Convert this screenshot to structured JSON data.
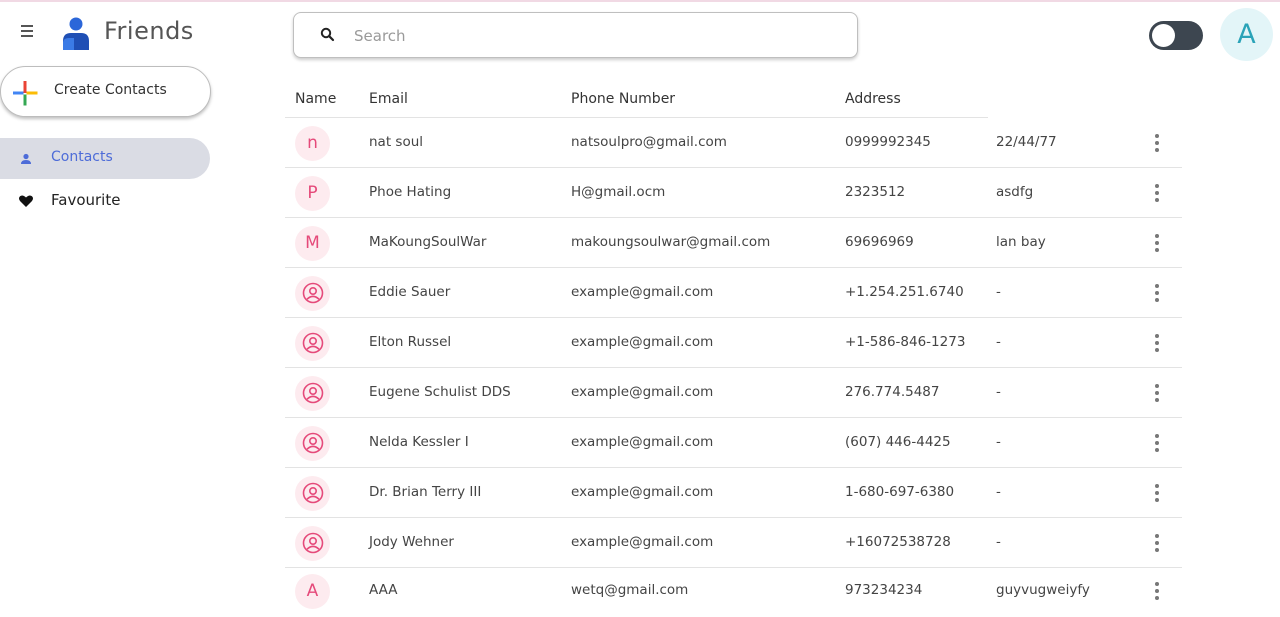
{
  "header": {
    "app_title": "Friends",
    "search_placeholder": "Search",
    "search_value": "",
    "avatar_letter": "A",
    "theme_toggle_on": false
  },
  "sidebar": {
    "create_label": "Create Contacts",
    "items": [
      {
        "label": "Contacts",
        "icon": "person-icon",
        "active": true
      },
      {
        "label": "Favourite",
        "icon": "heart-icon",
        "active": false
      }
    ]
  },
  "table": {
    "columns": [
      "Name",
      "Email",
      "Phone Number",
      "Address"
    ],
    "rows": [
      {
        "avatar": "n",
        "name": "nat soul",
        "email": "natsoulpro@gmail.com",
        "phone": "0999992345",
        "address": "22/44/77"
      },
      {
        "avatar": "P",
        "name": "Phoe Hating",
        "email": "H@gmail.ocm",
        "phone": "2323512",
        "address": "asdfg"
      },
      {
        "avatar": "M",
        "name": "MaKoungSoulWar",
        "email": "makoungsoulwar@gmail.com",
        "phone": "69696969",
        "address": "lan bay"
      },
      {
        "avatar": "",
        "name": "Eddie Sauer",
        "email": "example@gmail.com",
        "phone": "+1.254.251.6740",
        "address": "-"
      },
      {
        "avatar": "",
        "name": "Elton Russel",
        "email": "example@gmail.com",
        "phone": "+1-586-846-1273",
        "address": "-"
      },
      {
        "avatar": "",
        "name": "Eugene Schulist DDS",
        "email": "example@gmail.com",
        "phone": "276.774.5487",
        "address": "-"
      },
      {
        "avatar": "",
        "name": "Nelda Kessler I",
        "email": "example@gmail.com",
        "phone": "(607) 446-4425",
        "address": "-"
      },
      {
        "avatar": "",
        "name": "Dr. Brian Terry III",
        "email": "example@gmail.com",
        "phone": "1-680-697-6380",
        "address": "-"
      },
      {
        "avatar": "",
        "name": "Jody Wehner",
        "email": "example@gmail.com",
        "phone": "+16072538728",
        "address": "-"
      },
      {
        "avatar": "A",
        "name": "AAA",
        "email": "wetq@gmail.com",
        "phone": "973234234",
        "address": "guyvugweiyfy"
      }
    ]
  },
  "colors": {
    "accent": "#4d6cd8",
    "avatar_text": "#e54a7a",
    "avatar_bg": "#fdebef",
    "profile_avatar": "#2aa3b8",
    "toggle_track": "#3d4650"
  }
}
